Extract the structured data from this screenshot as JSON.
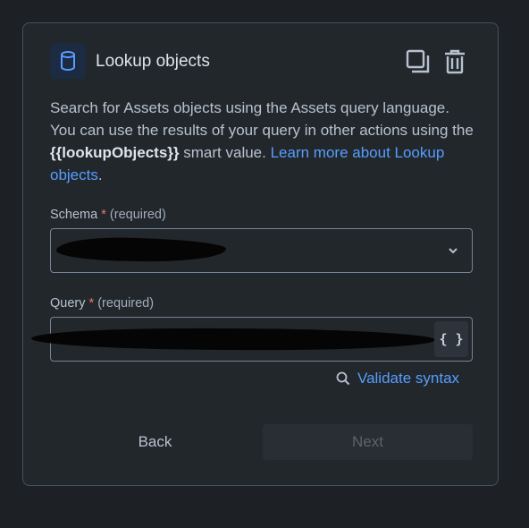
{
  "header": {
    "title": "Lookup objects",
    "icon": "database-icon",
    "copy_icon": "copy-icon",
    "delete_icon": "trash-icon"
  },
  "description": {
    "line_text": "Search for Assets objects using the Assets query language. You can use the results of your query in other actions using the ",
    "smart_value": "{{lookupObjects}}",
    "after_smart_value": " smart value. ",
    "link_text": "Learn more about Lookup objects",
    "end": "."
  },
  "schema": {
    "label": "Schema",
    "required_mark": "*",
    "required_text": "(required)",
    "value": "",
    "dropdown_icon": "chevron-down-icon"
  },
  "query": {
    "label": "Query",
    "required_mark": "*",
    "required_text": "(required)",
    "value": "",
    "code_button_icon": "code-braces-icon",
    "code_button_text": "{ }"
  },
  "validate": {
    "icon": "search-icon",
    "label": "Validate syntax"
  },
  "footer": {
    "back_label": "Back",
    "next_label": "Next"
  },
  "colors": {
    "background": "#1d2125",
    "panel": "#22272b",
    "link": "#579dff",
    "required": "#f87168",
    "disabled_text": "#59636e"
  }
}
